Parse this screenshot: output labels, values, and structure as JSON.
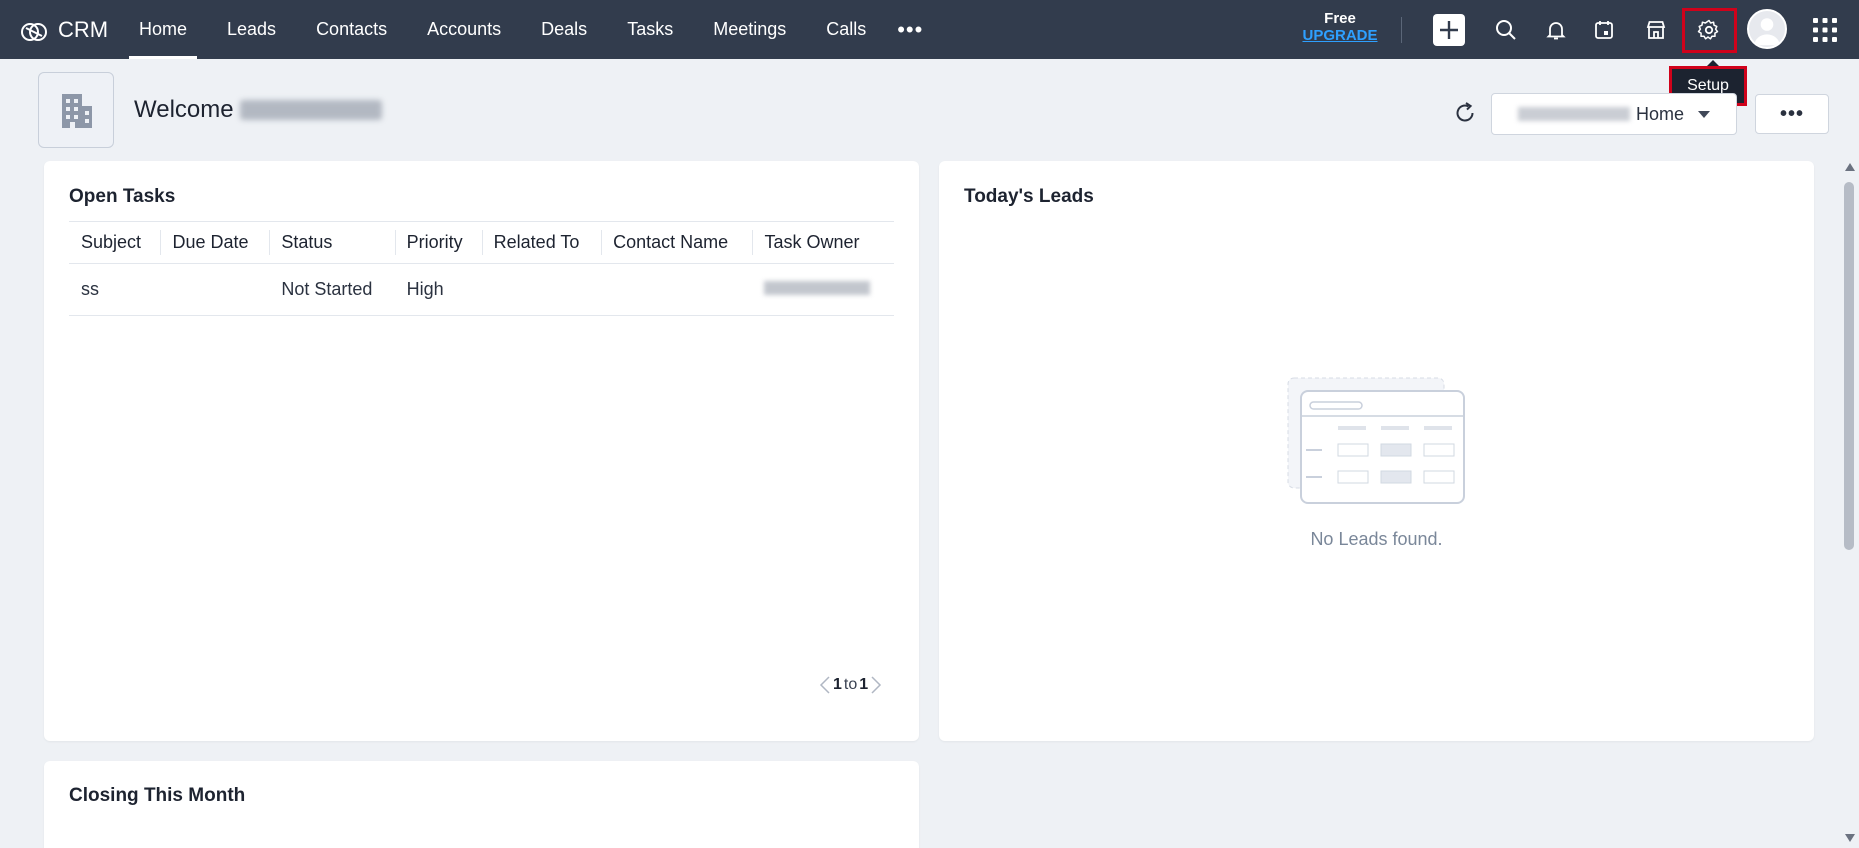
{
  "app": {
    "name": "CRM"
  },
  "nav": {
    "items": [
      "Home",
      "Leads",
      "Contacts",
      "Accounts",
      "Deals",
      "Tasks",
      "Meetings",
      "Calls"
    ],
    "active": "Home",
    "more": "•••"
  },
  "plan": {
    "label": "Free",
    "upgrade": "UPGRADE"
  },
  "topbar_icons": [
    "add-icon",
    "search-icon",
    "bell-icon",
    "calendar-icon",
    "marketplace-icon",
    "gear-icon",
    "avatar",
    "apps-grid-icon"
  ],
  "tooltip": {
    "text": "Setup"
  },
  "welcome": {
    "text": "Welcome"
  },
  "home_select": {
    "suffix": "Home"
  },
  "more_button": "•••",
  "open_tasks": {
    "title": "Open Tasks",
    "columns": [
      "Subject",
      "Due Date",
      "Status",
      "Priority",
      "Related To",
      "Contact Name",
      "Task Owner"
    ],
    "rows": [
      {
        "subject": "ss",
        "due_date": "",
        "status": "Not Started",
        "priority": "High",
        "related_to": "",
        "contact_name": ""
      }
    ],
    "pager": {
      "from": "1",
      "sep": "to",
      "to": "1"
    }
  },
  "todays_leads": {
    "title": "Today's Leads",
    "empty": "No Leads found."
  },
  "closing": {
    "title": "Closing This Month"
  },
  "colors": {
    "topbar": "#323c4d",
    "accent_link": "#2a77d4",
    "upgrade": "#2ea0ff",
    "highlight": "#d0021b",
    "background": "#eef1f5"
  }
}
